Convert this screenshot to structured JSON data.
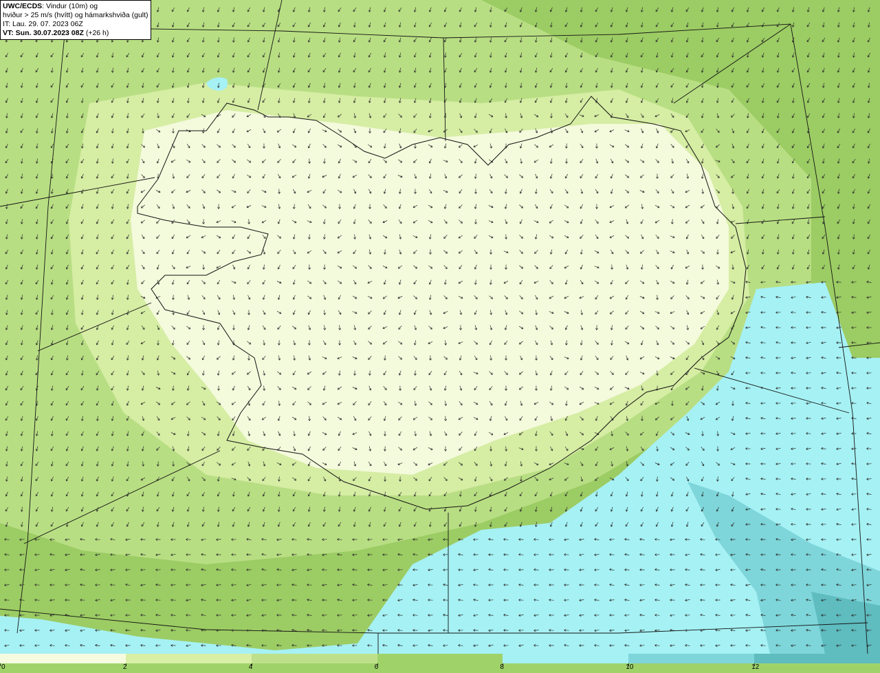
{
  "info": {
    "line1_bold": "UWC/ECDS",
    "line1_rest": ": Vindur (10m) og",
    "line2": "hviður > 25 m/s (hvítt) og hámarkshviða (gult)",
    "line3": "IT: Lau. 29. 07. 2023 06Z",
    "line4_bold": "VT: Sun. 30.07.2023 08Z",
    "line4_rest": " (+26 h)"
  },
  "legend": {
    "ticks": [
      "0",
      "2",
      "4",
      "6",
      "8",
      "10",
      "12"
    ],
    "colors": [
      "#f6fbe0",
      "#d9efa6",
      "#bfe08a",
      "#9fd36a",
      "#a6f1f4",
      "#7ed6da",
      "#5fbcbf"
    ]
  },
  "colors": {
    "land_calm": "#f4fadc",
    "wind_2_4": "#d6eda4",
    "wind_4_6": "#b8de83",
    "wind_6_8": "#9ccc64",
    "wind_8_10": "#a6f1f4",
    "wind_10_12": "#7ed6da",
    "wind_12_plus": "#5fbcbf"
  }
}
